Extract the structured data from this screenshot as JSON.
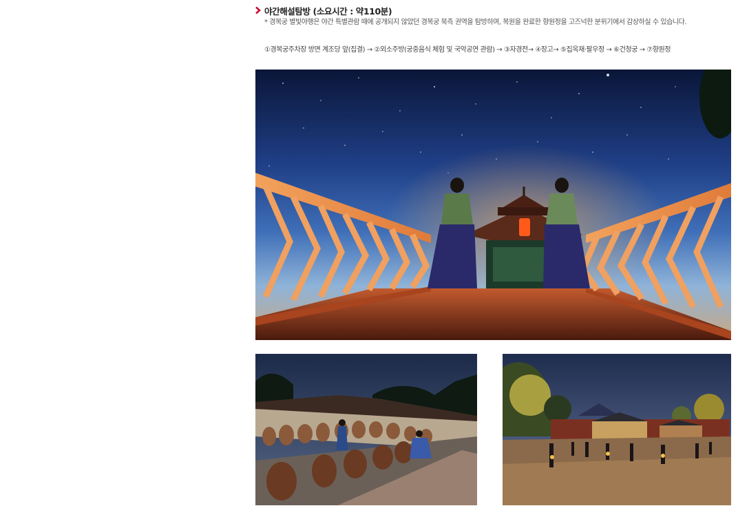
{
  "section": {
    "title": "야간해설탐방 (소요시간 : 약110분)",
    "description": "* 경복궁 별빛야행은 야간 특별관람 때에 공개되지 않았던 경복궁 북측 권역을 탐방하며, 복원을 완료한 향원정을 고즈넉한 분위기에서 감상하실 수 있습니다.",
    "route": "①경복궁주차장 방면 계조당 앞(집결) → ②외소주방(궁중음식 체험 및 국악공연 관람) → ③자경전→ ④장고→ ⑤집옥재·팔우정 → ⑥건청궁 → ⑦향원정"
  },
  "colors": {
    "accent": "#c8102e",
    "title": "#222222",
    "text": "#555555"
  },
  "icons": {
    "title_marker": "chevron-right-icon"
  }
}
